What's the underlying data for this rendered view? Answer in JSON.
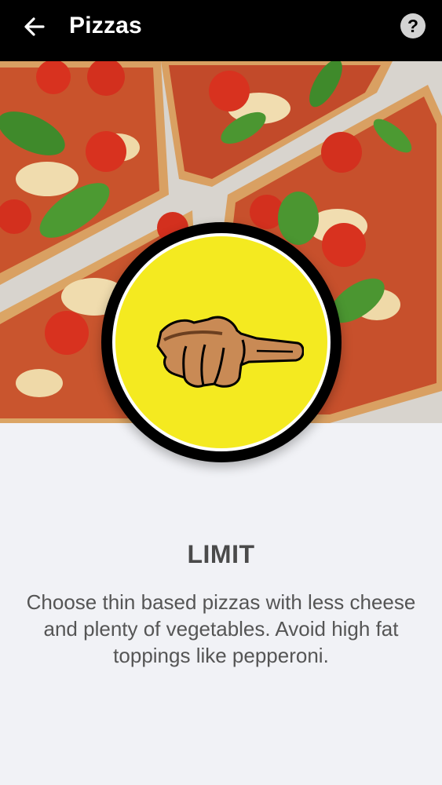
{
  "appbar": {
    "title": "Pizzas",
    "back_icon": "arrow-left-icon",
    "help_icon": "question-mark-icon",
    "help_glyph": "?",
    "background": "#000000"
  },
  "hero": {
    "image": "pizza-photo"
  },
  "badge": {
    "icon": "hand-pointing-icon",
    "ring_color": "#000000",
    "fill_color": "#f4ea20"
  },
  "content": {
    "heading": "LIMIT",
    "description": "Choose thin based pizzas with less cheese and plenty of vegetables. Avoid high fat toppings like pepperoni."
  }
}
